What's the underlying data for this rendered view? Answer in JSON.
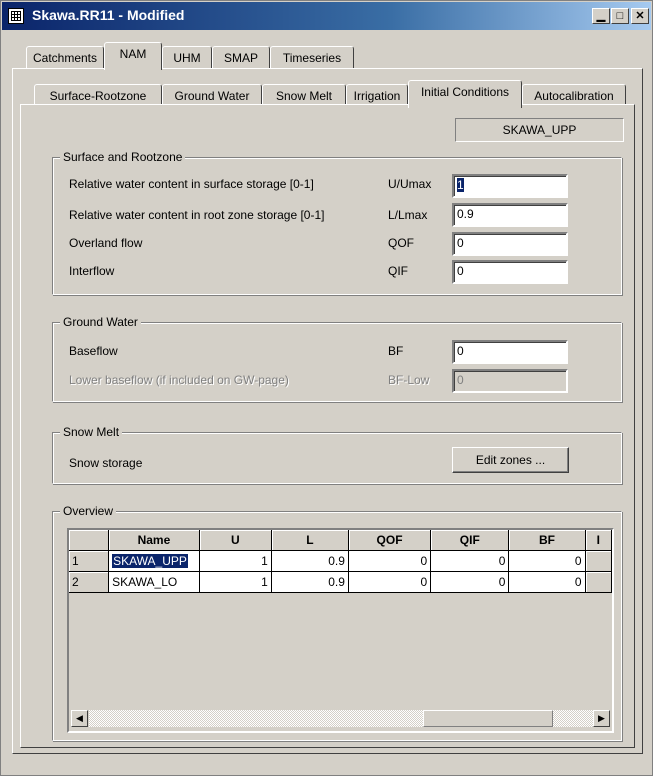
{
  "window": {
    "title": "Skawa.RR11 - Modified",
    "icons": [
      "app-grid-icon",
      "minimize-icon",
      "maximize-icon",
      "close-icon"
    ]
  },
  "top_tabs": [
    "Catchments",
    "NAM",
    "UHM",
    "SMAP",
    "Timeseries"
  ],
  "sub_tabs": [
    "Surface-Rootzone",
    "Ground Water",
    "Snow Melt",
    "Irrigation",
    "Initial Conditions",
    "Autocalibration"
  ],
  "catchment_id": "SKAWA_UPP",
  "surface_rootzone": {
    "title": "Surface and Rootzone",
    "rows": [
      {
        "label": "Relative water content in surface storage [0-1]",
        "code": "U/Umax",
        "value": "1"
      },
      {
        "label": "Relative water content in root zone storage [0-1]",
        "code": "L/Lmax",
        "value": "0.9"
      },
      {
        "label": "Overland flow",
        "code": "QOF",
        "value": "0"
      },
      {
        "label": "Interflow",
        "code": "QIF",
        "value": "0"
      }
    ]
  },
  "ground_water": {
    "title": "Ground Water",
    "baseflow": {
      "label": "Baseflow",
      "code": "BF",
      "value": "0"
    },
    "lower_baseflow": {
      "label": "Lower baseflow (if included on GW-page)",
      "code": "BF-Low",
      "value": "0"
    }
  },
  "snow_melt": {
    "title": "Snow Melt",
    "label": "Snow storage",
    "button": "Edit zones ..."
  },
  "overview": {
    "title": "Overview",
    "columns": [
      "",
      "Name",
      "U",
      "L",
      "QOF",
      "QIF",
      "BF",
      "I"
    ],
    "rows": [
      {
        "n": "1",
        "name": "SKAWA_UPP",
        "u": "1",
        "l": "0.9",
        "qof": "0",
        "qif": "0",
        "bf": "0"
      },
      {
        "n": "2",
        "name": "SKAWA_LO",
        "u": "1",
        "l": "0.9",
        "qof": "0",
        "qif": "0",
        "bf": "0"
      }
    ]
  },
  "colors": {
    "title_bar": "#0a246a",
    "face": "#d4d0c8",
    "selection": "#0a246a"
  }
}
